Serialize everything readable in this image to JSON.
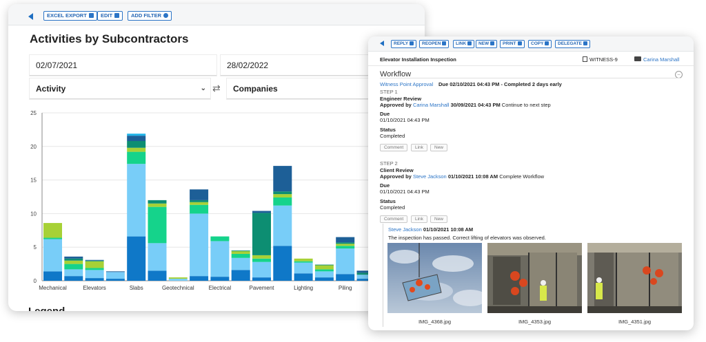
{
  "report_window": {
    "toolbar": {
      "excel_export": "EXCEL EXPORT",
      "edit": "EDIT",
      "add_filter": "ADD FILTER"
    },
    "title": "Activities by Subcontractors",
    "filters": {
      "date_from": "02/07/2021",
      "date_to": "28/02/2022",
      "activity": "Activity",
      "companies": "Companies"
    },
    "legend_title": "Legend"
  },
  "chart_data": {
    "type": "bar",
    "stacked": true,
    "ylim": [
      0,
      25
    ],
    "yticks": [
      0,
      5,
      10,
      15,
      20,
      25
    ],
    "grid": true,
    "categories_all": [
      "Mechanical",
      "c2",
      "Elevators",
      "c4",
      "Slabs",
      "c6",
      "Geotechnical",
      "c8",
      "Electrical",
      "c10",
      "Pavement",
      "c12",
      "Lighting",
      "c14",
      "Piling",
      "c16"
    ],
    "category_labels": [
      "Mechanical",
      "",
      "Elevators",
      "",
      "Slabs",
      "",
      "Geotechnical",
      "",
      "Electrical",
      "",
      "Pavement",
      "",
      "Lighting",
      "",
      "Piling",
      ""
    ],
    "series": [
      {
        "color": "#0f78c8",
        "values": [
          1.4,
          0.7,
          0.4,
          0.3,
          6.6,
          1.5,
          0,
          0.7,
          0.6,
          1.6,
          0.5,
          5.2,
          1.1,
          0.5,
          1.0,
          0.3
        ]
      },
      {
        "color": "#78cdf8",
        "values": [
          4.8,
          1.0,
          1.2,
          1.0,
          10.8,
          4.1,
          0.3,
          9.3,
          5.3,
          1.8,
          2.3,
          6.0,
          1.6,
          0.9,
          3.8,
          0.6
        ]
      },
      {
        "color": "#15d38b",
        "values": [
          0.2,
          0.8,
          0.3,
          0,
          1.8,
          5.4,
          0,
          1.3,
          0.7,
          0.6,
          0.5,
          1.2,
          0.2,
          0.3,
          0.4,
          0
        ]
      },
      {
        "color": "#a7d136",
        "values": [
          2.2,
          0.5,
          1.0,
          0,
          0.6,
          0.5,
          0.2,
          0.4,
          0,
          0.4,
          0.5,
          0.5,
          0.4,
          0.6,
          0.3,
          0
        ]
      },
      {
        "color": "#0d8e72",
        "values": [
          0,
          0.3,
          0.1,
          0,
          1.0,
          0.5,
          0,
          0.3,
          0,
          0.1,
          6.3,
          0.4,
          0,
          0.1,
          0.2,
          0.3
        ]
      },
      {
        "color": "#1d5f97",
        "values": [
          0,
          0.3,
          0.1,
          0.1,
          0.8,
          0,
          0,
          1.6,
          0,
          0,
          0.3,
          3.8,
          0,
          0,
          0.8,
          0.3
        ]
      },
      {
        "color": "#1eb4e8",
        "values": [
          0,
          0,
          0,
          0,
          0.3,
          0,
          0,
          0,
          0,
          0,
          0,
          0,
          0,
          0,
          0,
          0
        ]
      }
    ]
  },
  "detail_window": {
    "toolbar": [
      "REPLY",
      "REOPEN",
      "LINK",
      "NEW",
      "PRINT",
      "COPY",
      "DELEGATE"
    ],
    "header": {
      "title": "Elevator Installation Inspection",
      "witness": "WITNESS-9",
      "user": "Carina Marshall"
    },
    "workflow": {
      "title": "Workflow",
      "approval_name": "Witness Point Approval",
      "approval_due": "Due 02/10/2021 04:43 PM - Completed 2 days early",
      "step1": {
        "label": "STEP 1",
        "name": "Engineer Review",
        "approved_by": "Approved by",
        "approver": "Carina Marshall",
        "datetime": "30/09/2021 04:43 PM",
        "action": "Continue to next step",
        "due_label": "Due",
        "due_value": "01/10/2021 04:43 PM",
        "status_label": "Status",
        "status_value": "Completed"
      },
      "step2": {
        "label": "STEP 2",
        "name": "Client Review",
        "approved_by": "Approved by",
        "approver": "Steve Jackson",
        "datetime": "01/10/2021 10:08 AM",
        "action": "Complete Workflow",
        "due_label": "Due",
        "due_value": "01/10/2021 04:43 PM",
        "status_label": "Status",
        "status_value": "Completed"
      },
      "actions": {
        "comment": "Comment",
        "link": "Link",
        "new": "New"
      }
    },
    "comment": {
      "author": "Steve Jackson",
      "datetime": "01/10/2021 10:08 AM",
      "text": "The inspection has passed. Correct lifting of elevators was observed.",
      "images": [
        "IMG_4368.jpg",
        "IMG_4353.jpg",
        "IMG_4351.jpg"
      ]
    }
  }
}
